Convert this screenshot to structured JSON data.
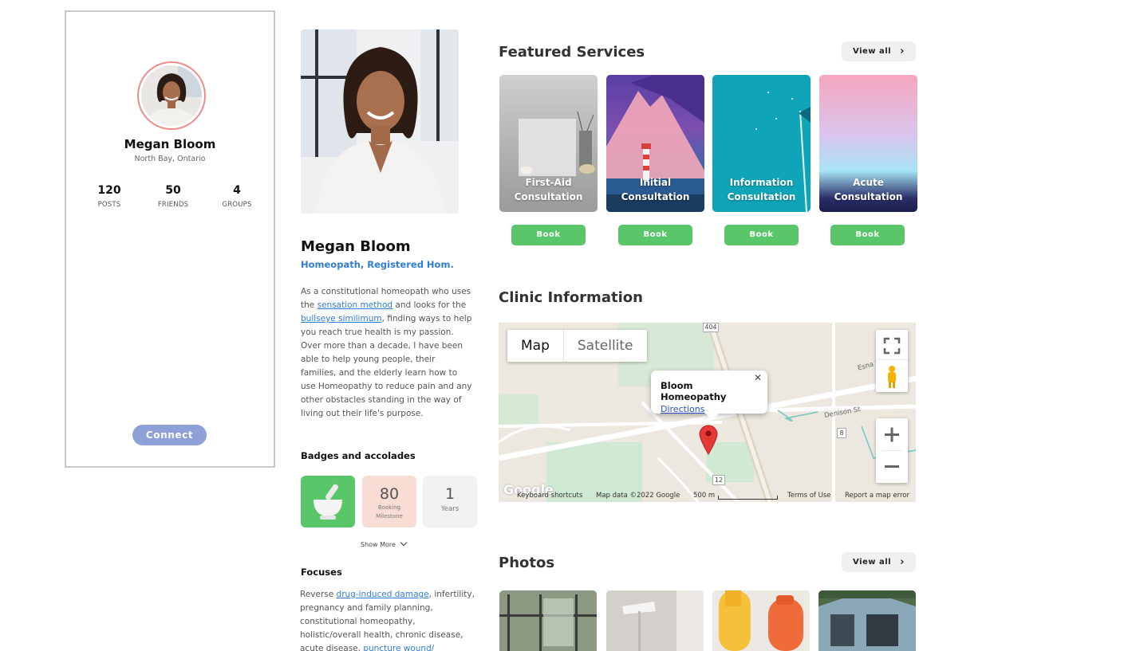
{
  "profile_card": {
    "name": "Megan Bloom",
    "location": "North Bay, Ontario",
    "stats": [
      {
        "value": "120",
        "label": "POSTS"
      },
      {
        "value": "50",
        "label": "FRIENDS"
      },
      {
        "value": "4",
        "label": "GROUPS"
      }
    ],
    "connect_label": "Connect"
  },
  "profile": {
    "name": "Megan Bloom",
    "title": "Homeopath, Registered Hom.",
    "bio": {
      "part1": "As a constitutional homeopath who uses the ",
      "link1": "sensation method",
      "part2": " and looks for the ",
      "link2": "bullseye similimum",
      "part3": ", finding ways to help you reach true health is my passion. Over more than a decade, I have been able to help young people, their families, and the elderly learn how to use Homeopathy to reduce pain and any other obstacles standing in the way of living out their life's purpose."
    },
    "badges_heading": "Badges and accolades",
    "badges": [
      {
        "value": "80",
        "label_line1": "Booking",
        "label_line2": "Milestone"
      },
      {
        "value": "1",
        "label_line1": "Years",
        "label_line2": ""
      }
    ],
    "show_more": "Show More",
    "focuses_heading": "Focuses",
    "focuses": {
      "part1": "Reverse ",
      "link1": "drug-induced damage",
      "part2": ", infertility, pregnancy and family planning, constitutional homeopathy, holistic/overall health, chronic disease, acute disease, ",
      "link2": "puncture wound/"
    }
  },
  "featured": {
    "heading": "Featured Services",
    "view_all": "View all",
    "book_label": "Book",
    "services": [
      {
        "line1": "First-Aid",
        "line2": "Consultation"
      },
      {
        "line1": "Initial",
        "line2": "Consultation"
      },
      {
        "line1": "Information",
        "line2": "Consultation"
      },
      {
        "line1": "Acute",
        "line2": "Consultation"
      }
    ]
  },
  "clinic": {
    "heading": "Clinic Information",
    "map": {
      "tab_map": "Map",
      "tab_satellite": "Satellite",
      "place_name": "Bloom Homeopathy",
      "directions": "Directions",
      "road_labels": [
        "404",
        "8",
        "12",
        "Denison St",
        "Esna"
      ],
      "google_logo": "Google",
      "footer": {
        "shortcuts": "Keyboard shortcuts",
        "map_data": "Map data ©2022 Google",
        "scale": "500 m",
        "terms": "Terms of Use",
        "report": "Report a map error"
      }
    }
  },
  "photos": {
    "heading": "Photos",
    "view_all": "View all"
  },
  "colors": {
    "accent_blue": "#2f7ddb",
    "book_green": "#5ac66a",
    "connect_blue": "#8ea0d8",
    "avatar_ring": "#f08b8b"
  }
}
